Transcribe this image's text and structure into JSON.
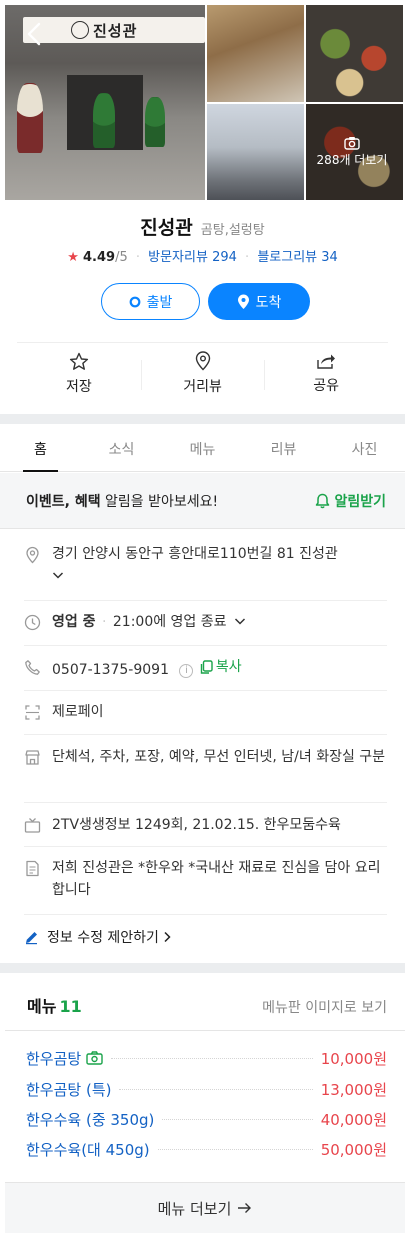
{
  "photos": {
    "more_label": "288개 더보기"
  },
  "store_sign": "진성관",
  "header": {
    "name": "진성관",
    "category": "곰탕,설렁탕",
    "rating": "4.49",
    "rating_max": "/5",
    "visitor_reviews": "방문자리뷰 294",
    "blog_reviews": "블로그리뷰 34"
  },
  "route": {
    "start_label": "출발",
    "arrive_label": "도착"
  },
  "utilities": {
    "save_label": "저장",
    "street_label": "거리뷰",
    "share_label": "공유"
  },
  "tabs": [
    "홈",
    "소식",
    "메뉴",
    "리뷰",
    "사진"
  ],
  "event": {
    "bold": "이벤트, 혜택",
    "rest": " 알림을 받아보세요!",
    "action": "알림받기"
  },
  "info": {
    "address": "경기 안양시 동안구 흥안대로110번길 81 진성관",
    "status": "영업 중",
    "hours": "21:00에 영업 종료",
    "phone": "0507-1375-9091",
    "copy_label": "복사",
    "payment": "제로페이",
    "amenities": "단체석, 주차, 포장, 예약, 무선 인터넷, 남/녀 화장실 구분",
    "tv": "2TV생생정보 1249회, 21.02.15. 한우모둠수육",
    "description": "저희 진성관은 *한우와 *국내산 재료로 진심을 담아 요리합니다",
    "edit_label": "정보 수정 제안하기"
  },
  "menu": {
    "title": "메뉴",
    "count": "11",
    "image_link": "메뉴판 이미지로 보기",
    "items": [
      {
        "name": "한우곰탕",
        "price": "10,000원"
      },
      {
        "name": "한우곰탕 (특)",
        "price": "13,000원"
      },
      {
        "name": "한우수육 (중 350g)",
        "price": "40,000원"
      },
      {
        "name": "한우수육(대 450g)",
        "price": "50,000원"
      }
    ],
    "more_label": "메뉴 더보기"
  },
  "colors": {
    "accent": "#0a84ff",
    "green": "#1aa34a",
    "price": "#e8454c",
    "link": "#1462c4"
  }
}
